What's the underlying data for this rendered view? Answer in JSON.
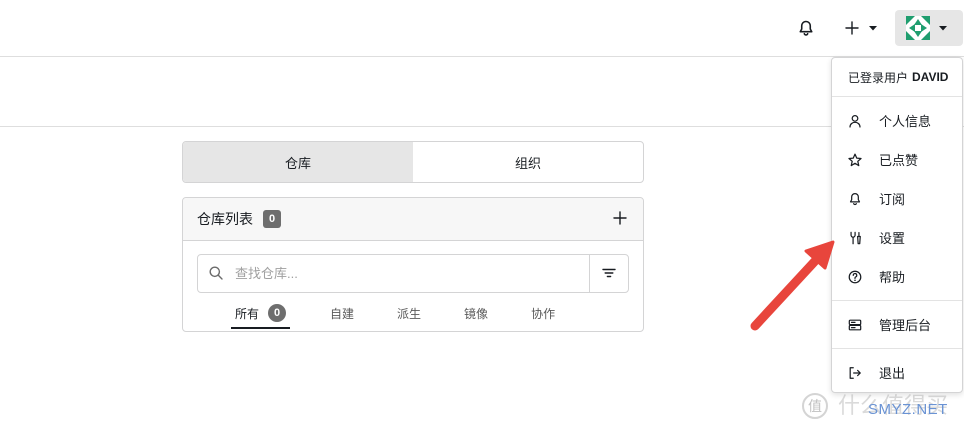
{
  "header": {
    "icons": {
      "notifications": "bell-icon",
      "create": "plus-icon",
      "create_caret": "caret-down-icon",
      "user_avatar": "avatar",
      "user_caret": "caret-down-icon"
    }
  },
  "dashboard_tabs": [
    {
      "label": "仓库",
      "active": true
    },
    {
      "label": "组织",
      "active": false
    }
  ],
  "repo_panel": {
    "title": "仓库列表",
    "count": "0",
    "add_icon": "plus-icon",
    "search": {
      "placeholder": "查找仓库...",
      "value": ""
    },
    "search_icon": "search-icon",
    "filter_icon": "filter-icon",
    "filters": [
      {
        "label": "所有",
        "count": "0",
        "active": true
      },
      {
        "label": "自建",
        "active": false
      },
      {
        "label": "派生",
        "active": false
      },
      {
        "label": "镜像",
        "active": false
      },
      {
        "label": "协作",
        "active": false
      }
    ]
  },
  "user_menu": {
    "signed_in_prefix": "已登录用户",
    "username": "DAVID",
    "items": [
      {
        "label": "个人信息",
        "icon": "person-icon"
      },
      {
        "label": "已点赞",
        "icon": "star-icon"
      },
      {
        "label": "订阅",
        "icon": "bell-icon"
      },
      {
        "label": "设置",
        "icon": "tools-icon"
      },
      {
        "label": "帮助",
        "icon": "question-icon"
      },
      {
        "label": "管理后台",
        "icon": "server-icon"
      },
      {
        "label": "退出",
        "icon": "sign-out-icon"
      }
    ]
  },
  "watermark": {
    "logo_char": "值",
    "site_name": "什么值得买",
    "domain": "SMYZ.NET"
  },
  "colors": {
    "active_tab_bg": "#e6e6e6",
    "badge_bg": "#6e6e6e",
    "avatar_green": "#1f9e6f",
    "annotation_arrow": "#e8453c",
    "watermark_blue": "#6a93d4"
  }
}
